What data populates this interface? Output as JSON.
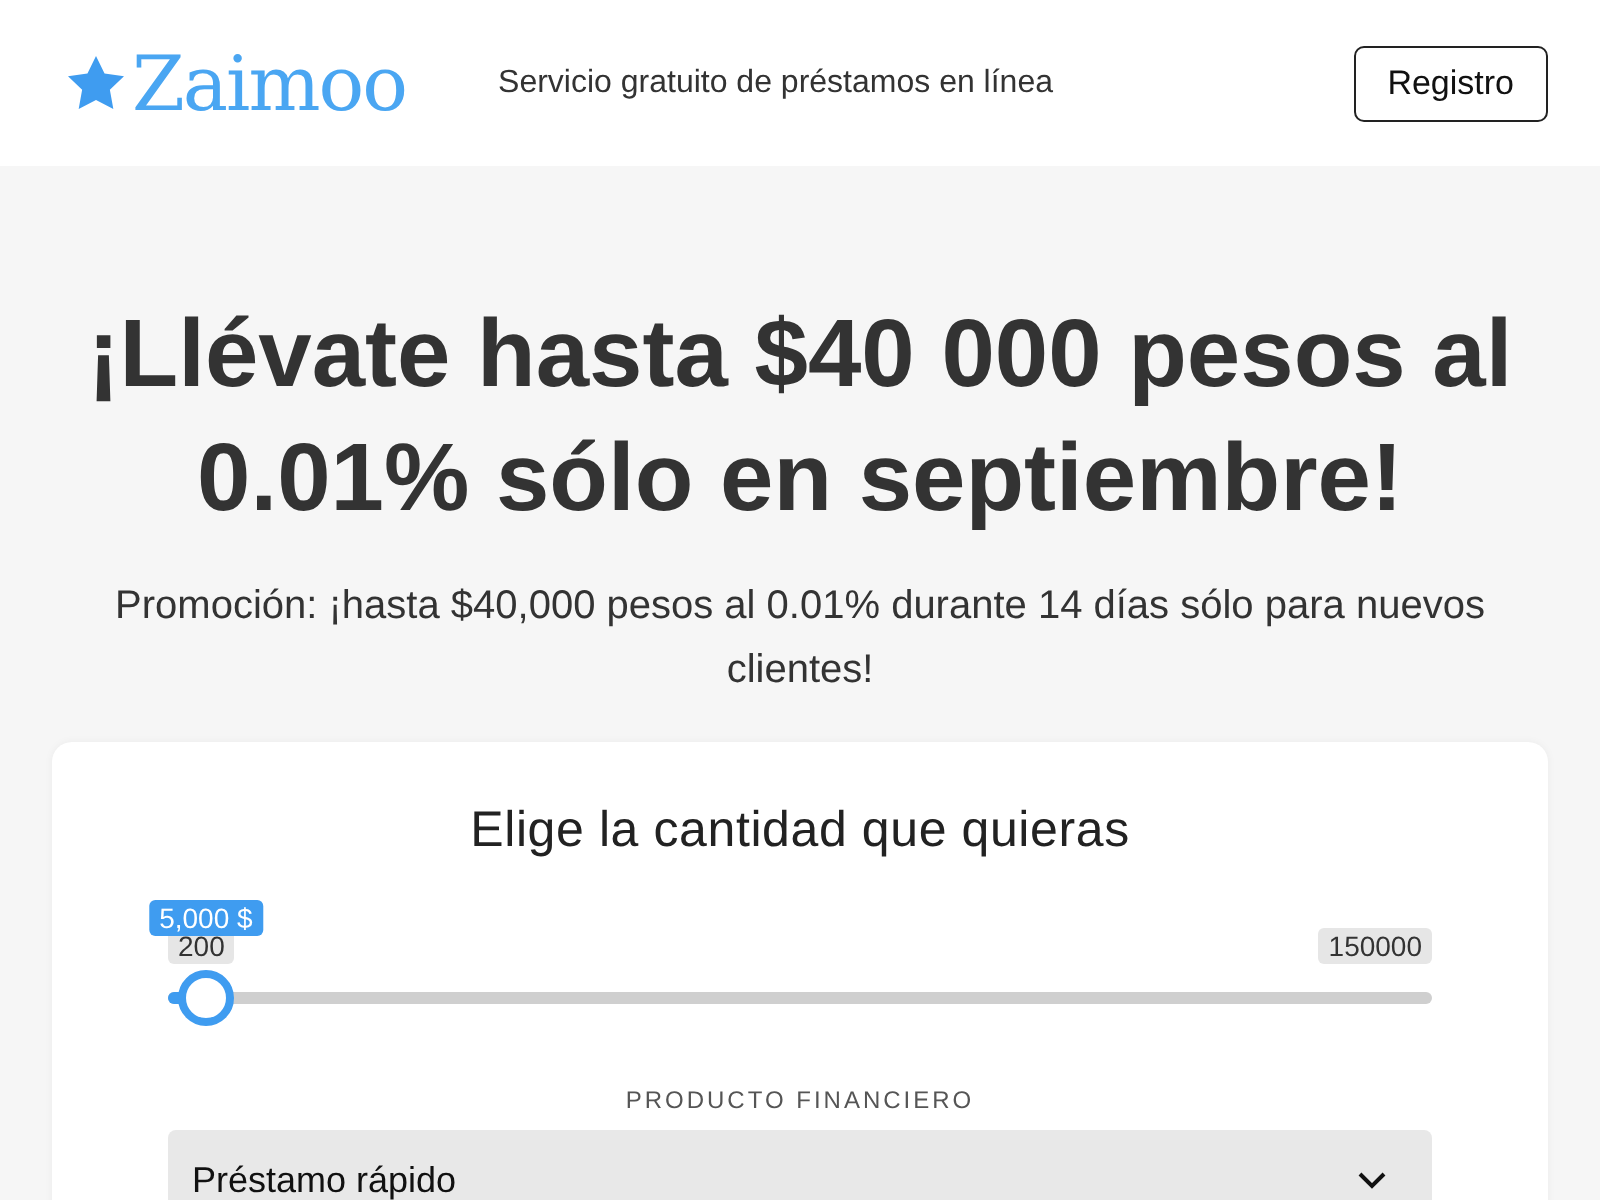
{
  "header": {
    "logo": "Zaimoo",
    "tagline": "Servicio gratuito de préstamos en línea",
    "button": "Registro"
  },
  "hero": {
    "title": "¡Llévate hasta $40 000 pesos al 0.01% sólo en septiembre!",
    "subtitle": "Promoción: ¡hasta $40,000 pesos al 0.01% durante 14 días sólo para nuevos clientes!"
  },
  "card": {
    "title": "Elige la cantidad que quieras",
    "slider": {
      "tooltip": "5,000 $",
      "min": "200",
      "max": "150000",
      "level": 0.03
    },
    "product_label": "PRODUCTO FINANCIERO",
    "product_select": {
      "value": "Préstamo rápido"
    }
  }
}
